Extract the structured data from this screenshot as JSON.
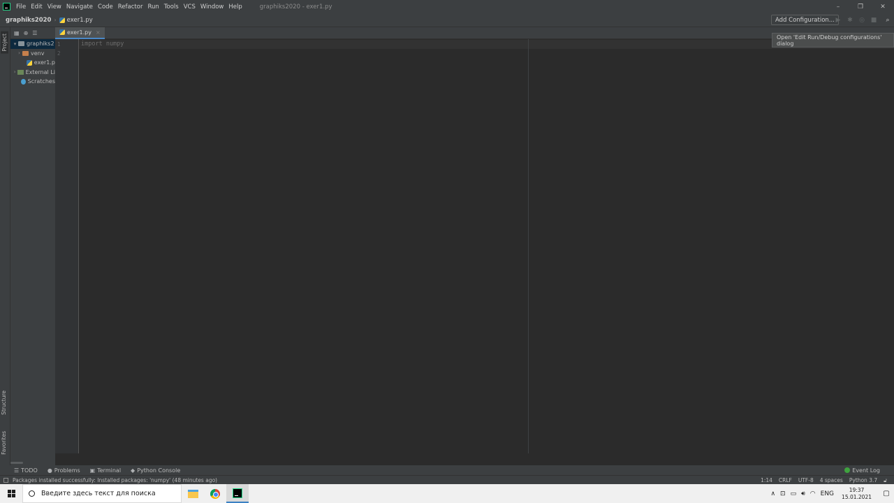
{
  "window": {
    "menu": [
      "File",
      "Edit",
      "View",
      "Navigate",
      "Code",
      "Refactor",
      "Run",
      "Tools",
      "VCS",
      "Window",
      "Help"
    ],
    "title": "graphiks2020 - exer1.py",
    "controls": {
      "minimize": "–",
      "restore": "❐",
      "close": "✕"
    }
  },
  "navbar": {
    "project": "graphiks2020",
    "file": "exer1.py",
    "add_config": "Add Configuration...",
    "tooltip": "Open 'Edit Run/Debug configurations' dialog"
  },
  "side_tabs": {
    "project": "Project",
    "structure": "Structure",
    "favorites": "Favorites"
  },
  "project_tree": [
    {
      "label": "graphiks2",
      "arrow": "▾",
      "kind": "folder-blue",
      "indent": 0,
      "selected": true
    },
    {
      "label": "venv",
      "arrow": "›",
      "kind": "folder-orange",
      "indent": 1,
      "selected": false
    },
    {
      "label": "exer1.p",
      "arrow": "",
      "kind": "py-file",
      "indent": 2,
      "selected": false
    },
    {
      "label": "External Li",
      "arrow": "›",
      "kind": "library",
      "indent": 0,
      "selected": false
    },
    {
      "label": "Scratches",
      "arrow": "",
      "kind": "scratch",
      "indent": 1,
      "selected": false
    }
  ],
  "editor": {
    "tab_label": "exer1.py",
    "tab_close": "×",
    "line_numbers": [
      "1",
      "2"
    ],
    "lines": [
      "import numpy",
      ""
    ]
  },
  "tool_windows": {
    "todo": "TODO",
    "problems": "Problems",
    "terminal": "Terminal",
    "python_console": "Python Console",
    "event_log": "Event Log"
  },
  "status": {
    "message": "Packages installed successfully: Installed packages: 'numpy' (48 minutes ago)",
    "position": "1:14",
    "line_sep": "CRLF",
    "encoding": "UTF-8",
    "indent": "4 spaces",
    "interpreter": "Python 3.7"
  },
  "taskbar": {
    "search_placeholder": "Введите здесь текст для поиска",
    "lang": "ENG",
    "time": "19:37",
    "date": "15.01.2021"
  },
  "colors": {
    "accent": "#4a88c7",
    "editor_bg": "#2b2b2b",
    "panel_bg": "#3c3f41"
  }
}
